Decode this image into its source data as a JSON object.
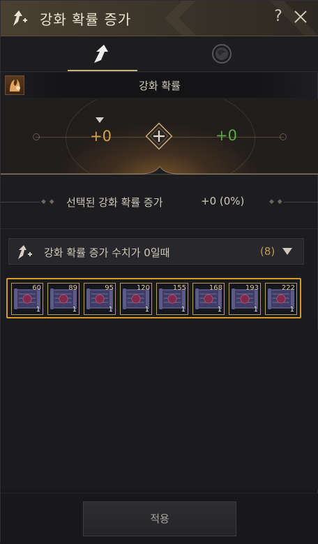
{
  "window": {
    "title": "강화 확률 증가"
  },
  "header_buttons": {
    "help": "?"
  },
  "section": {
    "title": "강화 확률"
  },
  "rate": {
    "current": "+0",
    "result": "+0"
  },
  "selected": {
    "label": "선택된 강화 확률 증가",
    "value": "+0 (0%)"
  },
  "dropdown": {
    "label": "강화 확률 증가 수치가 0일때",
    "count": "(8)"
  },
  "items": [
    {
      "value": "60",
      "qty": "1"
    },
    {
      "value": "89",
      "qty": "1"
    },
    {
      "value": "95",
      "qty": "1"
    },
    {
      "value": "120",
      "qty": "1"
    },
    {
      "value": "155",
      "qty": "1"
    },
    {
      "value": "168",
      "qty": "1"
    },
    {
      "value": "193",
      "qty": "1"
    },
    {
      "value": "222",
      "qty": "1"
    }
  ],
  "footer": {
    "apply_label": "적용"
  },
  "icons": {
    "title": "enhance-arrow-icon",
    "tab1": "enhance-arrow-icon",
    "tab2": "globe-swirl-icon",
    "section": "enhance-character-icon",
    "dropdown": "enhance-arrow-icon",
    "item": "scroll-icon"
  },
  "colors": {
    "accent_gold": "#d6a443",
    "positive_green": "#5ea94a",
    "selection_border": "#d69a28"
  }
}
